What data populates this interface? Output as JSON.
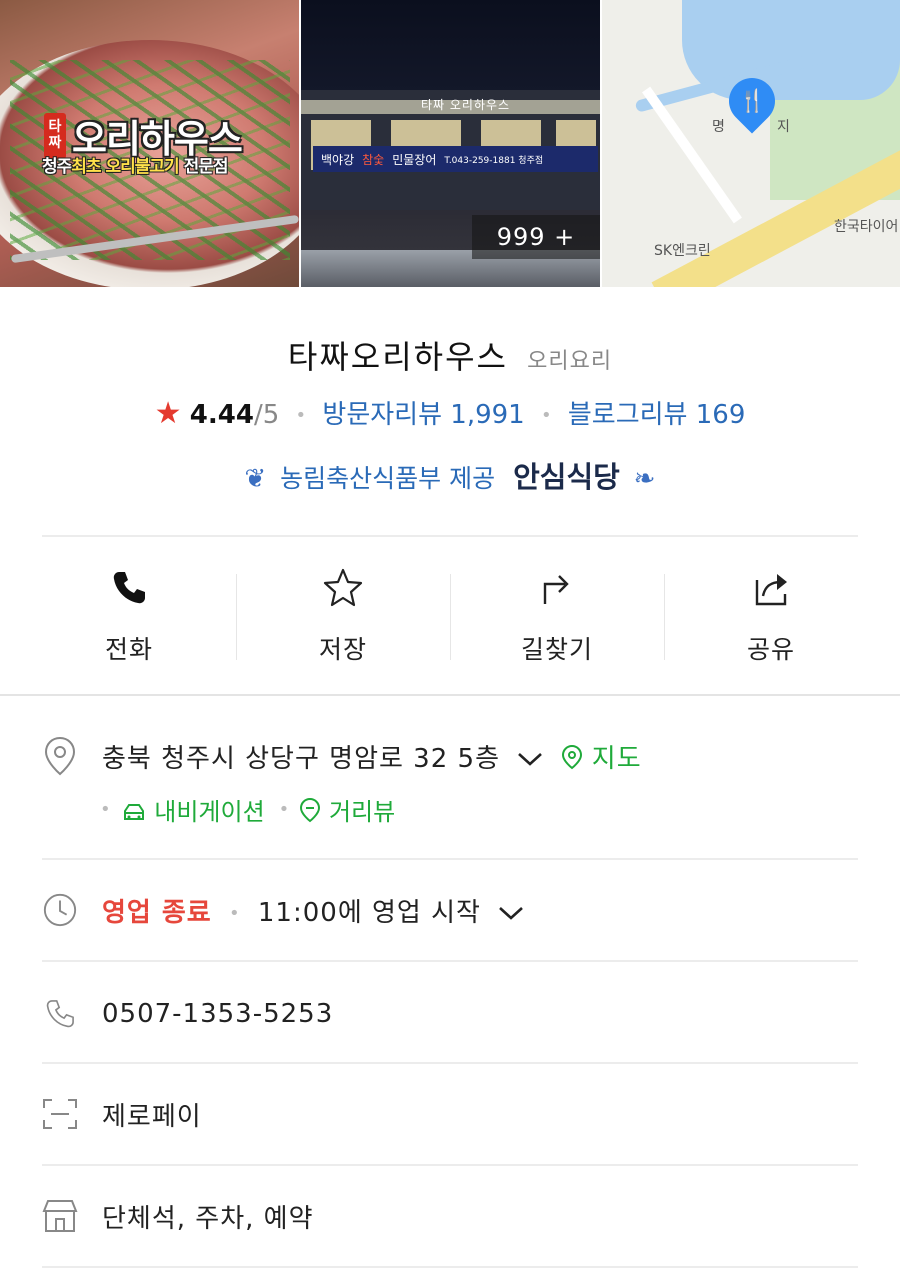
{
  "photos": {
    "logo_tag": "타짜",
    "logo_name": "오리하우스",
    "logo_sub_prefix": "청주",
    "logo_sub_highlight": "최초",
    "logo_sub_mid": "오리불고기",
    "logo_sub_suffix": "전문점",
    "night_sign_brand": "백야강",
    "night_sign_hot": "참숯",
    "night_sign_text": "민물장어",
    "night_sign_phone": "T.043-259-1881 청주점",
    "night_sign_top": "타짜 오리하우스",
    "count_label": "999 +",
    "map_label_1": "명",
    "map_label_2": "지",
    "map_label_3": "SK엔크린",
    "map_label_4": "한국타이어"
  },
  "place": {
    "name": "타짜오리하우스",
    "category": "오리요리",
    "rating_star": "★",
    "rating": "4.44",
    "rating_max": "/5",
    "visitor_reviews": "방문자리뷰 1,991",
    "blog_reviews": "블로그리뷰 169",
    "badge_provider": "농림축산식품부 제공",
    "badge_title": "안심식당"
  },
  "actions": [
    {
      "label": "전화",
      "icon": "phone-icon"
    },
    {
      "label": "저장",
      "icon": "star-icon"
    },
    {
      "label": "길찾기",
      "icon": "directions-icon"
    },
    {
      "label": "공유",
      "icon": "share-icon"
    }
  ],
  "info": {
    "address": "충북 청주시 상당구 명암로 32 5층",
    "map_link": "지도",
    "navigation_link": "내비게이션",
    "street_view_link": "거리뷰",
    "hours_status": "영업 종료",
    "hours_next": "11:00에 영업 시작",
    "phone": "0507-1353-5253",
    "payment": "제로페이",
    "amenities": "단체석, 주차, 예약"
  },
  "colors": {
    "accent_blue": "#2a6ab7",
    "accent_green": "#1faa3a",
    "status_red": "#e6473c",
    "star_red": "#e43a2f"
  }
}
